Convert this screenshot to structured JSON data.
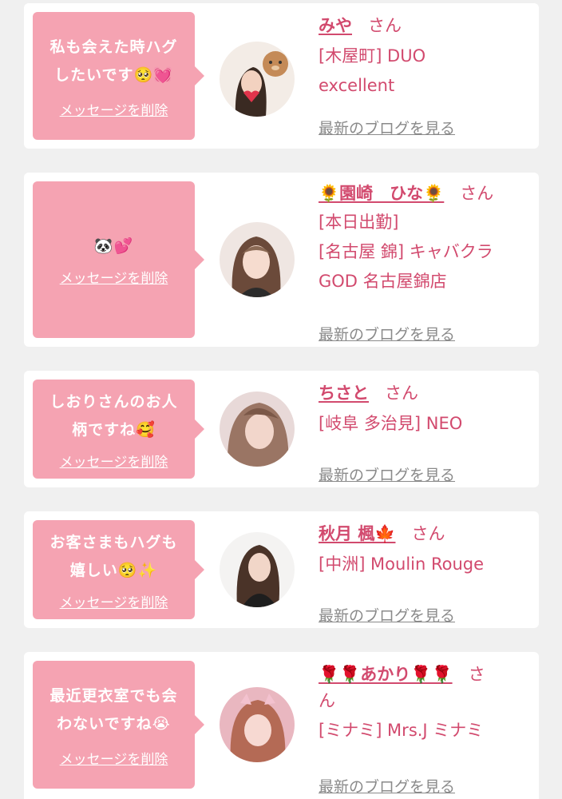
{
  "messages": [
    {
      "message": "私も会えた時ハグ\nしたいです🥺💓",
      "delete_label": "メッセージを削除",
      "name": "みや",
      "san": "さん",
      "info": [
        "[木屋町] DUO",
        "excellent"
      ],
      "blog_label": "最新のブログを見る"
    },
    {
      "message": "🐼💕",
      "delete_label": "メッセージを削除",
      "name": "🌻園崎　ひな🌻",
      "san": "さん",
      "info": [
        "[本日出勤]",
        "[名古屋 錦] キャバクラ",
        "GOD 名古屋錦店"
      ],
      "blog_label": "最新のブログを見る"
    },
    {
      "message": "しおりさんのお人\n柄ですね🥰",
      "delete_label": "メッセージを削除",
      "name": "ちさと",
      "san": "さん",
      "info": [
        "[岐阜 多治見] NEO"
      ],
      "blog_label": "最新のブログを見る"
    },
    {
      "message": "お客さまもハグも\n嬉しい🥺✨",
      "delete_label": "メッセージを削除",
      "name": "秋月 楓🍁",
      "san": "さん",
      "info": [
        "[中洲] Moulin Rouge"
      ],
      "blog_label": "最新のブログを見る"
    },
    {
      "message": "最近更衣室でも会\nわないですね😭",
      "delete_label": "メッセージを削除",
      "name": "🌹🌹あかり🌹🌹",
      "san": "さ",
      "san2": "ん",
      "info": [
        "[ミナミ] Mrs.J ミナミ"
      ],
      "blog_label": "最新のブログを見る"
    }
  ]
}
